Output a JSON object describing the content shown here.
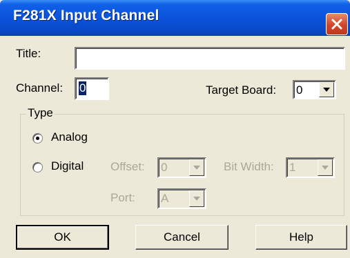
{
  "window": {
    "title": "F281X Input Channel",
    "close_icon": "close-icon"
  },
  "form": {
    "title_label": "Title:",
    "title_value": "",
    "channel_label": "Channel:",
    "channel_value": "0",
    "target_board_label": "Target Board:",
    "target_board_value": "0"
  },
  "type_group": {
    "caption": "Type",
    "analog_label": "Analog",
    "analog_selected": true,
    "digital_label": "Digital",
    "digital_selected": false,
    "offset_label": "Offset:",
    "offset_value": "0",
    "bit_width_label": "Bit Width:",
    "bit_width_value": "1",
    "port_label": "Port:",
    "port_value": "A"
  },
  "buttons": {
    "ok": "OK",
    "cancel": "Cancel",
    "help": "Help"
  },
  "colors": {
    "titlebar": "#0a52d8",
    "close": "#d1462a",
    "face": "#ece9d8",
    "disabled_text": "#aca899"
  }
}
